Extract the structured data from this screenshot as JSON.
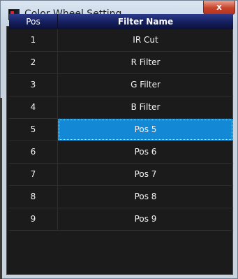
{
  "window": {
    "title": "Color Wheel Setting",
    "close_glyph": "x",
    "icon": "app-icon"
  },
  "table": {
    "headers": {
      "pos": "Pos",
      "name": "Filter Name"
    },
    "rows": [
      {
        "pos": "1",
        "name": "IR Cut"
      },
      {
        "pos": "2",
        "name": "R Filter"
      },
      {
        "pos": "3",
        "name": "G Filter"
      },
      {
        "pos": "4",
        "name": "B Filter"
      },
      {
        "pos": "5",
        "name": "Pos 5"
      },
      {
        "pos": "6",
        "name": "Pos 6"
      },
      {
        "pos": "7",
        "name": "Pos 7"
      },
      {
        "pos": "8",
        "name": "Pos 8"
      },
      {
        "pos": "9",
        "name": "Pos 9"
      }
    ],
    "selected_row_index": 4
  }
}
